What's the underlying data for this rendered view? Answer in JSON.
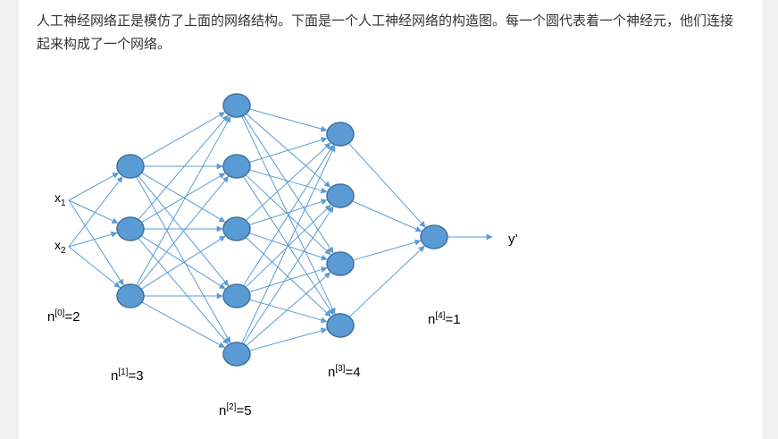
{
  "paragraph": {
    "text": "人工神经网络正是模仿了上面的网络结构。下面是一个人工神经网络的构造图。每一个圆代表着一个神经元，他们连接起来构成了一个网络。"
  },
  "diagram": {
    "input_labels": [
      {
        "base": "x",
        "sub": "1"
      },
      {
        "base": "x",
        "sub": "2"
      }
    ],
    "output_label": "y’",
    "layer_size_labels": [
      {
        "base": "n",
        "sup": "[0]",
        "rest": "=2"
      },
      {
        "base": "n",
        "sup": "[1]",
        "rest": "=3"
      },
      {
        "base": "n",
        "sup": "[2]",
        "rest": "=5"
      },
      {
        "base": "n",
        "sup": "[3]",
        "rest": "=4"
      },
      {
        "base": "n",
        "sup": "[4]",
        "rest": "=1"
      }
    ],
    "layer_sizes": [
      2,
      3,
      5,
      4,
      1
    ],
    "node_color": "#5b9bd5",
    "node_stroke": "#41719c",
    "edge_color": "#5b9bd5"
  }
}
